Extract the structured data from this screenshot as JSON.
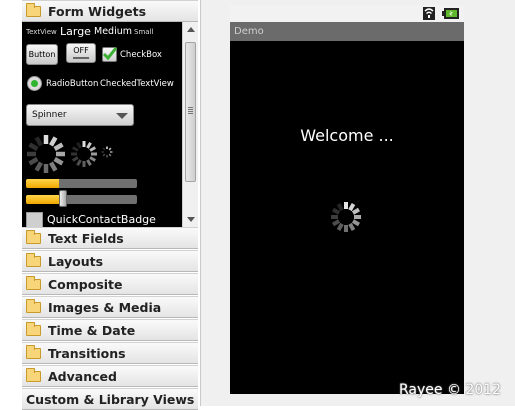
{
  "palette": {
    "categories": [
      {
        "label": "Form Widgets"
      },
      {
        "label": "Text Fields"
      },
      {
        "label": "Layouts"
      },
      {
        "label": "Composite"
      },
      {
        "label": "Images & Media"
      },
      {
        "label": "Time & Date"
      },
      {
        "label": "Transitions"
      },
      {
        "label": "Advanced"
      },
      {
        "label": "Custom & Library Views"
      }
    ],
    "widgets": {
      "textview_label": "TextView",
      "large_label": "Large",
      "medium_label": "Medium",
      "small_label": "Small",
      "button_label": "Button",
      "toggle_label": "OFF",
      "checkbox_label": "CheckBox",
      "radiobutton_label": "RadioButton",
      "checkedtextview_label": "CheckedTextView",
      "spinner_label": "Spinner",
      "quickcontactbadge_label": "QuickContactBadge",
      "progress_values": [
        0.3,
        0.3
      ],
      "seekbar_value": 0.33
    }
  },
  "device": {
    "app_title": "Demo",
    "welcome_text": "Welcome ..."
  },
  "watermark": "Rayee © 2012",
  "colors": {
    "accent_orange": "#f0a800",
    "radio_green": "#2fb52f",
    "device_background": "#000000",
    "title_bar": "#6b6b6b",
    "battery_green": "#5fb82c"
  }
}
